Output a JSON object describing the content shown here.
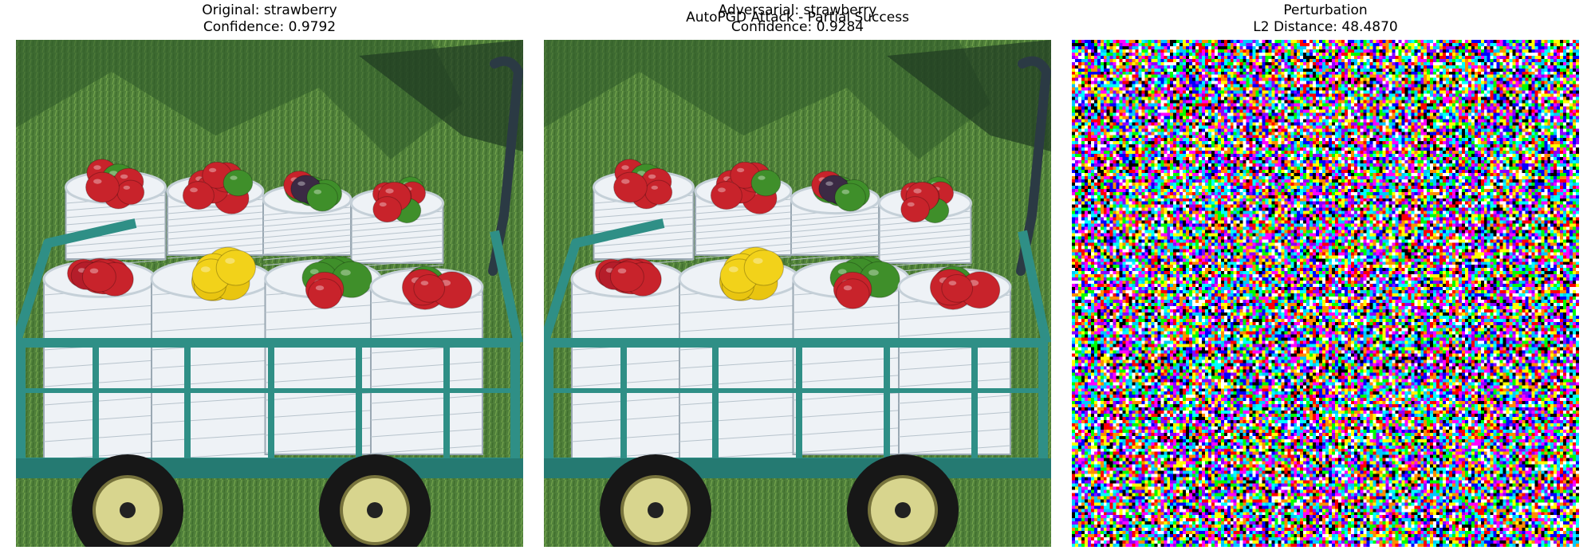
{
  "figure": {
    "suptitle": "AutoPGD Attack - Partial Success"
  },
  "panels": [
    {
      "line1": "Original: strawberry",
      "line2": "Confidence: 0.9792",
      "content": "photo of a green garden wagon holding white buckets of red, green and yellow bell peppers on grass"
    },
    {
      "line1": "Adversarial: strawberry",
      "line2": "Confidence: 0.9284",
      "content": "same photo with imperceptible adversarial perturbation"
    },
    {
      "line1": "Perturbation",
      "line2": "L2 Distance: 48.4870",
      "content": "dense multicolor pixel noise"
    }
  ],
  "colors": {
    "grass": "#4f7f3a",
    "grass_dark": "#2f5a2a",
    "wagon": "#2f8f86",
    "bucket": "#eef2f6",
    "pepper_red": "#c8232b",
    "pepper_yellow": "#f2d21a",
    "pepper_green": "#3f8f2a"
  }
}
